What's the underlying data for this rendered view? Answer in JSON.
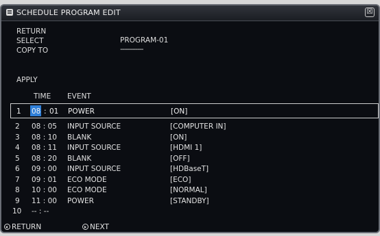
{
  "window": {
    "title": "SCHEDULE  PROGRAM EDIT",
    "close_glyph": "☒"
  },
  "menu": {
    "return": "RETURN",
    "select": "SELECT",
    "select_value": "PROGRAM-01",
    "copy_to": "COPY TO",
    "copy_to_value": "------------",
    "apply": "APPLY"
  },
  "table": {
    "headers": {
      "time": "TIME",
      "event": "EVENT"
    },
    "selected": {
      "num": "1",
      "hour": "08",
      "sep": ":",
      "minute": "01",
      "event": "POWER",
      "value": "[ON]"
    },
    "rows": [
      {
        "num": "2",
        "time": "08 : 05",
        "event": "INPUT SOURCE",
        "value": "[COMPUTER IN]"
      },
      {
        "num": "3",
        "time": "08 : 10",
        "event": "BLANK",
        "value": "[ON]"
      },
      {
        "num": "4",
        "time": "08 : 11",
        "event": "INPUT SOURCE",
        "value": "[HDMI 1]"
      },
      {
        "num": "5",
        "time": "08 : 20",
        "event": "BLANK",
        "value": "[OFF]"
      },
      {
        "num": "6",
        "time": "09 : 00",
        "event": "INPUT SOURCE",
        "value": "[HDBaseT]"
      },
      {
        "num": "7",
        "time": "09 : 01",
        "event": "ECO MODE",
        "value": "[ECO]"
      },
      {
        "num": "8",
        "time": "10 : 00",
        "event": "ECO MODE",
        "value": "[NORMAL]"
      },
      {
        "num": "9",
        "time": "11 : 00",
        "event": "POWER",
        "value": "[STANDBY]"
      },
      {
        "num": "10",
        "time": "-- : --",
        "event": "",
        "value": ""
      }
    ]
  },
  "footer": {
    "return_label": "RETURN",
    "next_label": "NEXT"
  }
}
